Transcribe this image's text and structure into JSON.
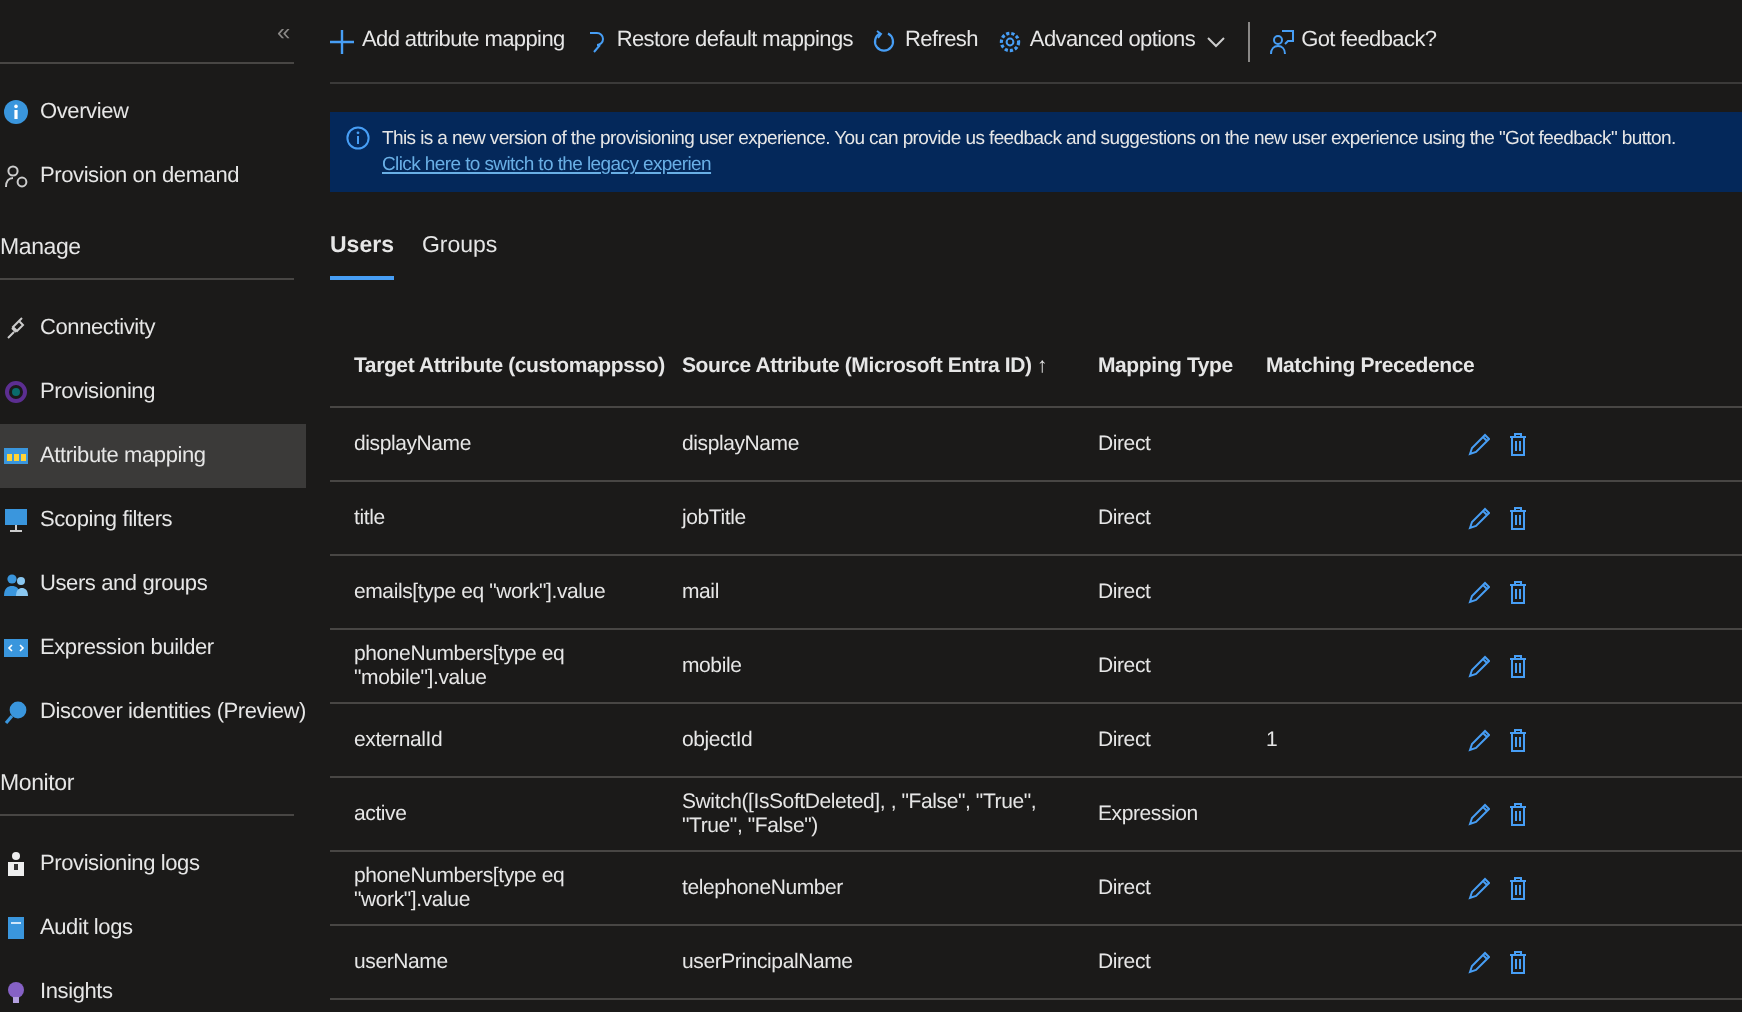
{
  "sidebar": {
    "collapse": "«",
    "groups": [
      {
        "items": [
          {
            "label": "Overview",
            "selected": false
          },
          {
            "label": "Provision on demand",
            "selected": false
          }
        ]
      },
      {
        "heading": "Manage",
        "items": [
          {
            "label": "Connectivity",
            "selected": false
          },
          {
            "label": "Provisioning",
            "selected": false
          },
          {
            "label": "Attribute mapping",
            "selected": true
          },
          {
            "label": "Scoping filters",
            "selected": false
          },
          {
            "label": "Users and groups",
            "selected": false
          },
          {
            "label": "Expression builder",
            "selected": false
          },
          {
            "label": "Discover identities (Preview)",
            "selected": false
          }
        ]
      },
      {
        "heading": "Monitor",
        "items": [
          {
            "label": "Provisioning logs",
            "selected": false
          },
          {
            "label": "Audit logs",
            "selected": false
          },
          {
            "label": "Insights",
            "selected": false
          }
        ]
      }
    ]
  },
  "toolbar": [
    {
      "label": "Add attribute mapping"
    },
    {
      "label": "Restore default mappings"
    },
    {
      "label": "Refresh"
    },
    {
      "label": "Advanced options",
      "dropdown": true
    },
    {
      "label": "Got feedback?"
    }
  ],
  "banner": {
    "text": "This is a new version of the provisioning user experience. You can provide us feedback and suggestions on the new user experience using the \"Got feedback\" button.",
    "link": "Click here to switch to the legacy experien"
  },
  "tabs": [
    {
      "label": "Users",
      "selected": true
    },
    {
      "label": "Groups",
      "selected": false
    }
  ],
  "table": {
    "columns": [
      "Target Attribute (customappsso)",
      "Source Attribute (Microsoft Entra ID) ↑",
      "Mapping Type",
      "Matching Precedence"
    ],
    "rows": [
      [
        "displayName",
        "displayName",
        "Direct",
        ""
      ],
      [
        "title",
        "jobTitle",
        "Direct",
        ""
      ],
      [
        "emails[type eq \"work\"].value",
        "mail",
        "Direct",
        ""
      ],
      [
        "phoneNumbers[type eq \"mobile\"].value",
        "mobile",
        "Direct",
        ""
      ],
      [
        "externalId",
        "objectId",
        "Direct",
        "1"
      ],
      [
        "active",
        "Switch([IsSoftDeleted], , \"False\", \"True\", \"True\", \"False\")",
        "Expression",
        ""
      ],
      [
        "phoneNumbers[type eq \"work\"].value",
        "telephoneNumber",
        "Direct",
        ""
      ],
      [
        "userName",
        "userPrincipalName",
        "Direct",
        ""
      ]
    ]
  }
}
